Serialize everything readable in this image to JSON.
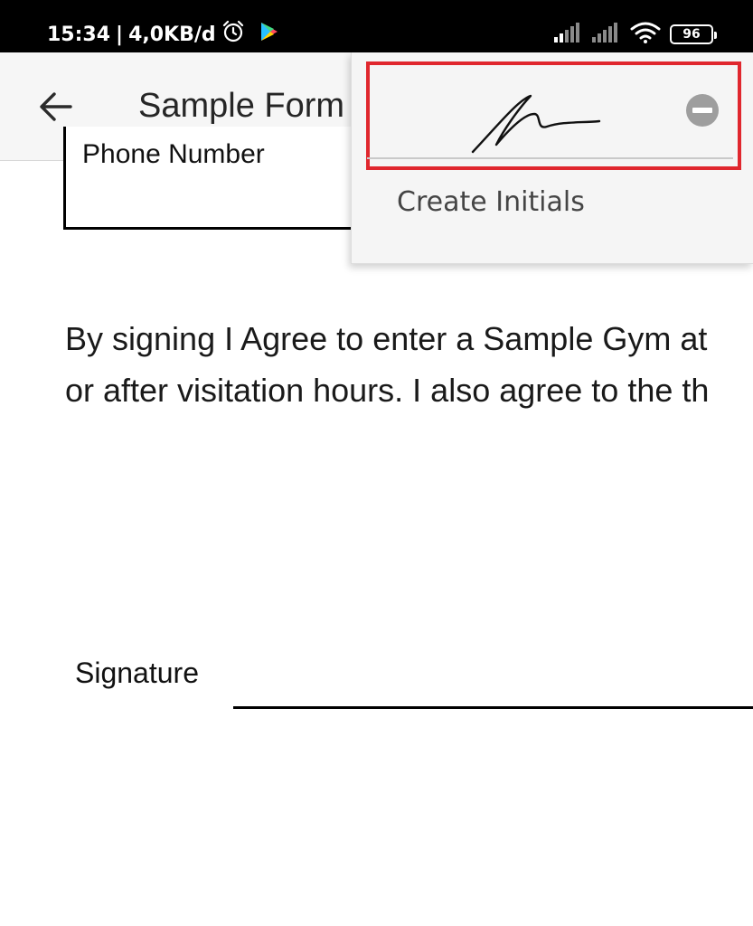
{
  "status_bar": {
    "time": "15:34",
    "separator": "|",
    "data_speed": "4,0KB/d",
    "battery_level": "96",
    "icons": [
      "alarm-icon",
      "app-notification-icon",
      "signal-icon",
      "signal-empty-icon",
      "wifi-icon",
      "battery-icon"
    ]
  },
  "app_bar": {
    "back_icon": "arrow-left-icon",
    "title": "Sample Form"
  },
  "document": {
    "phone_field_label": "Phone Number",
    "agreement_lines": [
      "By signing I Agree to enter a Sample Gym at",
      "or after visitation hours. I also agree to the th"
    ],
    "signature_label": "Signature"
  },
  "popup_menu": {
    "remove_icon": "minus-circle-icon",
    "create_initials_label": "Create Initials"
  },
  "colors": {
    "highlight": "#e0272e",
    "status_bar_bg": "#000000",
    "app_bar_bg": "#f6f6f6",
    "menu_bg": "#f5f5f5",
    "remove_icon": "#9e9e9e"
  }
}
